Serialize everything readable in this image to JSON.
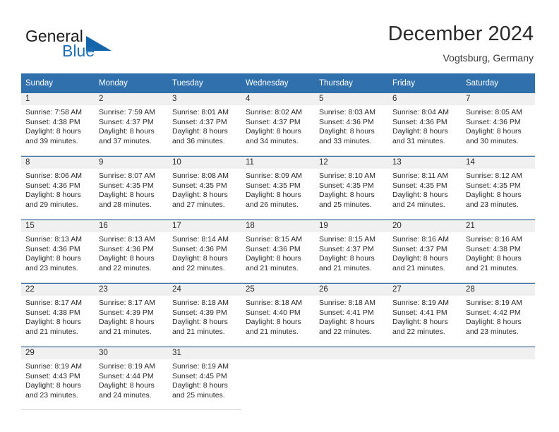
{
  "brand": {
    "name_part1": "General",
    "name_part2": "Blue",
    "triangle_color": "#1565aa",
    "blue_color": "#1e70b8"
  },
  "header": {
    "title": "December 2024",
    "location": "Vogtsburg, Germany"
  },
  "theme": {
    "header_bg": "#3071ad",
    "daynum_band_bg": "#f0f0f0",
    "grid_line": "#d6d6d6",
    "week_rule": "#3071ad"
  },
  "calendar": {
    "weekday_headers": [
      "Sunday",
      "Monday",
      "Tuesday",
      "Wednesday",
      "Thursday",
      "Friday",
      "Saturday"
    ],
    "weeks": [
      [
        {
          "day": "1",
          "sunrise": "Sunrise: 7:58 AM",
          "sunset": "Sunset: 4:38 PM",
          "daylight1": "Daylight: 8 hours",
          "daylight2": "and 39 minutes."
        },
        {
          "day": "2",
          "sunrise": "Sunrise: 7:59 AM",
          "sunset": "Sunset: 4:37 PM",
          "daylight1": "Daylight: 8 hours",
          "daylight2": "and 37 minutes."
        },
        {
          "day": "3",
          "sunrise": "Sunrise: 8:01 AM",
          "sunset": "Sunset: 4:37 PM",
          "daylight1": "Daylight: 8 hours",
          "daylight2": "and 36 minutes."
        },
        {
          "day": "4",
          "sunrise": "Sunrise: 8:02 AM",
          "sunset": "Sunset: 4:37 PM",
          "daylight1": "Daylight: 8 hours",
          "daylight2": "and 34 minutes."
        },
        {
          "day": "5",
          "sunrise": "Sunrise: 8:03 AM",
          "sunset": "Sunset: 4:36 PM",
          "daylight1": "Daylight: 8 hours",
          "daylight2": "and 33 minutes."
        },
        {
          "day": "6",
          "sunrise": "Sunrise: 8:04 AM",
          "sunset": "Sunset: 4:36 PM",
          "daylight1": "Daylight: 8 hours",
          "daylight2": "and 31 minutes."
        },
        {
          "day": "7",
          "sunrise": "Sunrise: 8:05 AM",
          "sunset": "Sunset: 4:36 PM",
          "daylight1": "Daylight: 8 hours",
          "daylight2": "and 30 minutes."
        }
      ],
      [
        {
          "day": "8",
          "sunrise": "Sunrise: 8:06 AM",
          "sunset": "Sunset: 4:36 PM",
          "daylight1": "Daylight: 8 hours",
          "daylight2": "and 29 minutes."
        },
        {
          "day": "9",
          "sunrise": "Sunrise: 8:07 AM",
          "sunset": "Sunset: 4:35 PM",
          "daylight1": "Daylight: 8 hours",
          "daylight2": "and 28 minutes."
        },
        {
          "day": "10",
          "sunrise": "Sunrise: 8:08 AM",
          "sunset": "Sunset: 4:35 PM",
          "daylight1": "Daylight: 8 hours",
          "daylight2": "and 27 minutes."
        },
        {
          "day": "11",
          "sunrise": "Sunrise: 8:09 AM",
          "sunset": "Sunset: 4:35 PM",
          "daylight1": "Daylight: 8 hours",
          "daylight2": "and 26 minutes."
        },
        {
          "day": "12",
          "sunrise": "Sunrise: 8:10 AM",
          "sunset": "Sunset: 4:35 PM",
          "daylight1": "Daylight: 8 hours",
          "daylight2": "and 25 minutes."
        },
        {
          "day": "13",
          "sunrise": "Sunrise: 8:11 AM",
          "sunset": "Sunset: 4:35 PM",
          "daylight1": "Daylight: 8 hours",
          "daylight2": "and 24 minutes."
        },
        {
          "day": "14",
          "sunrise": "Sunrise: 8:12 AM",
          "sunset": "Sunset: 4:35 PM",
          "daylight1": "Daylight: 8 hours",
          "daylight2": "and 23 minutes."
        }
      ],
      [
        {
          "day": "15",
          "sunrise": "Sunrise: 8:13 AM",
          "sunset": "Sunset: 4:36 PM",
          "daylight1": "Daylight: 8 hours",
          "daylight2": "and 23 minutes."
        },
        {
          "day": "16",
          "sunrise": "Sunrise: 8:13 AM",
          "sunset": "Sunset: 4:36 PM",
          "daylight1": "Daylight: 8 hours",
          "daylight2": "and 22 minutes."
        },
        {
          "day": "17",
          "sunrise": "Sunrise: 8:14 AM",
          "sunset": "Sunset: 4:36 PM",
          "daylight1": "Daylight: 8 hours",
          "daylight2": "and 22 minutes."
        },
        {
          "day": "18",
          "sunrise": "Sunrise: 8:15 AM",
          "sunset": "Sunset: 4:36 PM",
          "daylight1": "Daylight: 8 hours",
          "daylight2": "and 21 minutes."
        },
        {
          "day": "19",
          "sunrise": "Sunrise: 8:15 AM",
          "sunset": "Sunset: 4:37 PM",
          "daylight1": "Daylight: 8 hours",
          "daylight2": "and 21 minutes."
        },
        {
          "day": "20",
          "sunrise": "Sunrise: 8:16 AM",
          "sunset": "Sunset: 4:37 PM",
          "daylight1": "Daylight: 8 hours",
          "daylight2": "and 21 minutes."
        },
        {
          "day": "21",
          "sunrise": "Sunrise: 8:16 AM",
          "sunset": "Sunset: 4:38 PM",
          "daylight1": "Daylight: 8 hours",
          "daylight2": "and 21 minutes."
        }
      ],
      [
        {
          "day": "22",
          "sunrise": "Sunrise: 8:17 AM",
          "sunset": "Sunset: 4:38 PM",
          "daylight1": "Daylight: 8 hours",
          "daylight2": "and 21 minutes."
        },
        {
          "day": "23",
          "sunrise": "Sunrise: 8:17 AM",
          "sunset": "Sunset: 4:39 PM",
          "daylight1": "Daylight: 8 hours",
          "daylight2": "and 21 minutes."
        },
        {
          "day": "24",
          "sunrise": "Sunrise: 8:18 AM",
          "sunset": "Sunset: 4:39 PM",
          "daylight1": "Daylight: 8 hours",
          "daylight2": "and 21 minutes."
        },
        {
          "day": "25",
          "sunrise": "Sunrise: 8:18 AM",
          "sunset": "Sunset: 4:40 PM",
          "daylight1": "Daylight: 8 hours",
          "daylight2": "and 21 minutes."
        },
        {
          "day": "26",
          "sunrise": "Sunrise: 8:18 AM",
          "sunset": "Sunset: 4:41 PM",
          "daylight1": "Daylight: 8 hours",
          "daylight2": "and 22 minutes."
        },
        {
          "day": "27",
          "sunrise": "Sunrise: 8:19 AM",
          "sunset": "Sunset: 4:41 PM",
          "daylight1": "Daylight: 8 hours",
          "daylight2": "and 22 minutes."
        },
        {
          "day": "28",
          "sunrise": "Sunrise: 8:19 AM",
          "sunset": "Sunset: 4:42 PM",
          "daylight1": "Daylight: 8 hours",
          "daylight2": "and 23 minutes."
        }
      ],
      [
        {
          "day": "29",
          "sunrise": "Sunrise: 8:19 AM",
          "sunset": "Sunset: 4:43 PM",
          "daylight1": "Daylight: 8 hours",
          "daylight2": "and 23 minutes."
        },
        {
          "day": "30",
          "sunrise": "Sunrise: 8:19 AM",
          "sunset": "Sunset: 4:44 PM",
          "daylight1": "Daylight: 8 hours",
          "daylight2": "and 24 minutes."
        },
        {
          "day": "31",
          "sunrise": "Sunrise: 8:19 AM",
          "sunset": "Sunset: 4:45 PM",
          "daylight1": "Daylight: 8 hours",
          "daylight2": "and 25 minutes."
        },
        {
          "day": "",
          "sunrise": "",
          "sunset": "",
          "daylight1": "",
          "daylight2": ""
        },
        {
          "day": "",
          "sunrise": "",
          "sunset": "",
          "daylight1": "",
          "daylight2": ""
        },
        {
          "day": "",
          "sunrise": "",
          "sunset": "",
          "daylight1": "",
          "daylight2": ""
        },
        {
          "day": "",
          "sunrise": "",
          "sunset": "",
          "daylight1": "",
          "daylight2": ""
        }
      ]
    ]
  }
}
